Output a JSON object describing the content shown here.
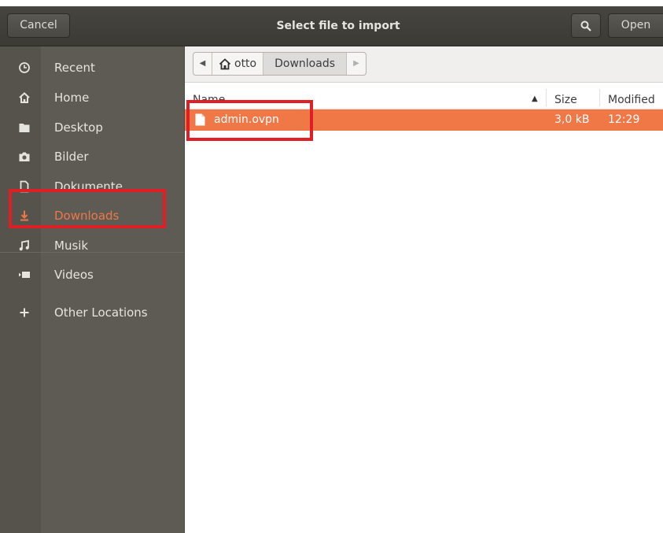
{
  "dialog": {
    "title": "Select file to import",
    "cancel_label": "Cancel",
    "open_label": "Open",
    "search_icon": "search-icon"
  },
  "sidebar": {
    "items": [
      {
        "label": "Recent",
        "icon": "clock-icon"
      },
      {
        "label": "Home",
        "icon": "home-icon"
      },
      {
        "label": "Desktop",
        "icon": "folder-icon"
      },
      {
        "label": "Bilder",
        "icon": "camera-icon"
      },
      {
        "label": "Dokumente",
        "icon": "document-icon"
      },
      {
        "label": "Downloads",
        "icon": "download-icon",
        "active": true
      },
      {
        "label": "Musik",
        "icon": "music-icon"
      },
      {
        "label": "Videos",
        "icon": "video-icon"
      }
    ],
    "other_locations": {
      "label": "Other Locations",
      "icon": "plus-icon"
    }
  },
  "pathbar": {
    "segments": [
      {
        "label": "otto",
        "icon": "home-icon"
      },
      {
        "label": "Downloads",
        "current": true
      }
    ]
  },
  "file_list": {
    "columns": {
      "name": "Name",
      "size": "Size",
      "modified": "Modified"
    },
    "rows": [
      {
        "name": "admin.ovpn",
        "size": "3,0 kB",
        "modified": "12:29",
        "selected": true
      }
    ]
  },
  "colors": {
    "accent": "#f07746",
    "annotation": "#e01e26",
    "sidebar_bg": "#5d5b53",
    "header_bg": "#3f3e39"
  }
}
